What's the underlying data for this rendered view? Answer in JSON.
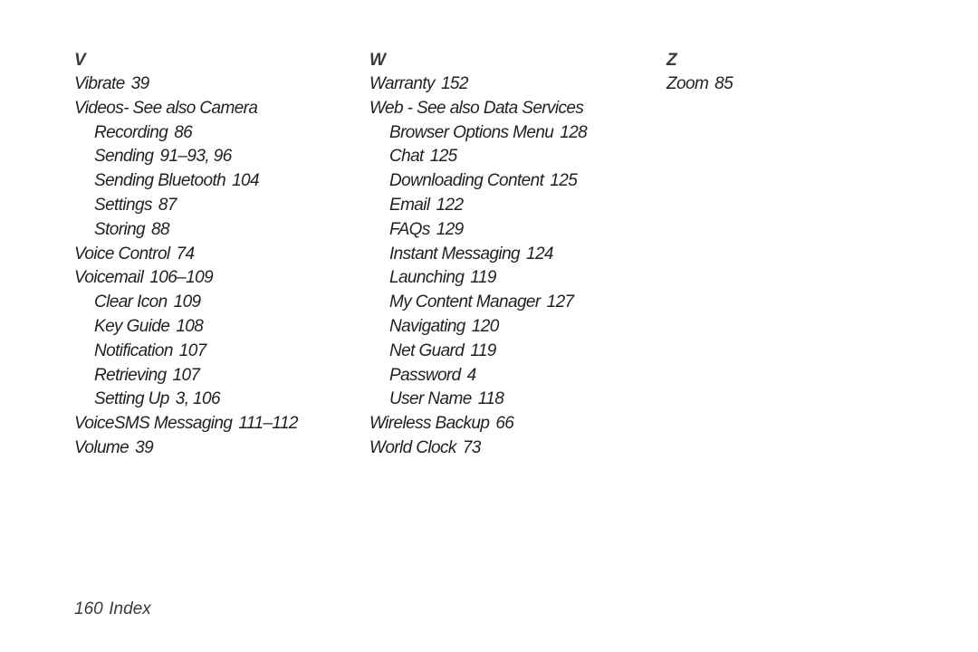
{
  "columns": [
    {
      "letter": "V",
      "entries": [
        {
          "term": "Vibrate",
          "pages": "39",
          "sub": false
        },
        {
          "term": "Videos- See also Camera",
          "pages": "",
          "sub": false
        },
        {
          "term": "Recording",
          "pages": "86",
          "sub": true
        },
        {
          "term": "Sending",
          "pages": "91–93, 96",
          "sub": true
        },
        {
          "term": "Sending Bluetooth",
          "pages": "104",
          "sub": true
        },
        {
          "term": "Settings",
          "pages": "87",
          "sub": true
        },
        {
          "term": "Storing",
          "pages": "88",
          "sub": true
        },
        {
          "term": "Voice Control",
          "pages": "74",
          "sub": false
        },
        {
          "term": "Voicemail",
          "pages": "106–109",
          "sub": false
        },
        {
          "term": "Clear Icon",
          "pages": "109",
          "sub": true
        },
        {
          "term": "Key Guide",
          "pages": "108",
          "sub": true
        },
        {
          "term": "Notification",
          "pages": "107",
          "sub": true
        },
        {
          "term": "Retrieving",
          "pages": "107",
          "sub": true
        },
        {
          "term": "Setting Up",
          "pages": "3, 106",
          "sub": true
        },
        {
          "term": "VoiceSMS Messaging",
          "pages": "111–112",
          "sub": false
        },
        {
          "term": "Volume",
          "pages": "39",
          "sub": false
        }
      ]
    },
    {
      "letter": "W",
      "entries": [
        {
          "term": "Warranty",
          "pages": "152",
          "sub": false
        },
        {
          "term": "Web - See also Data Services",
          "pages": "",
          "sub": false
        },
        {
          "term": "Browser Options Menu",
          "pages": "128",
          "sub": true
        },
        {
          "term": "Chat",
          "pages": "125",
          "sub": true
        },
        {
          "term": "Downloading Content",
          "pages": "125",
          "sub": true
        },
        {
          "term": "Email",
          "pages": "122",
          "sub": true
        },
        {
          "term": "FAQs",
          "pages": "129",
          "sub": true
        },
        {
          "term": "Instant Messaging",
          "pages": "124",
          "sub": true
        },
        {
          "term": "Launching",
          "pages": "119",
          "sub": true
        },
        {
          "term": "My Content Manager",
          "pages": "127",
          "sub": true
        },
        {
          "term": "Navigating",
          "pages": "120",
          "sub": true
        },
        {
          "term": "Net Guard",
          "pages": "119",
          "sub": true
        },
        {
          "term": "Password",
          "pages": "4",
          "sub": true
        },
        {
          "term": "User Name",
          "pages": "118",
          "sub": true
        },
        {
          "term": "Wireless Backup",
          "pages": "66",
          "sub": false
        },
        {
          "term": "World Clock",
          "pages": "73",
          "sub": false
        }
      ]
    },
    {
      "letter": "Z",
      "entries": [
        {
          "term": "Zoom",
          "pages": "85",
          "sub": false
        }
      ]
    }
  ],
  "footer": {
    "page_number": "160",
    "section_title": "Index"
  }
}
